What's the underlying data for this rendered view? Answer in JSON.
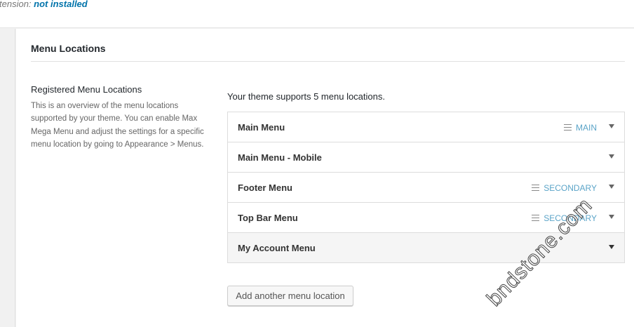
{
  "extension": {
    "label": "tension:",
    "status": "not installed"
  },
  "section": {
    "title": "Menu Locations"
  },
  "sidebar": {
    "heading": "Registered Menu Locations",
    "description": "This is an overview of the menu locations supported by your theme. You can enable Max Mega Menu and adjust the settings for a specific menu location by going to Appearance > Menus."
  },
  "main": {
    "intro": "Your theme supports 5 menu locations.",
    "locations": [
      {
        "name": "Main Menu",
        "tag": "MAIN",
        "icon": "menu-lines-icon"
      },
      {
        "name": "Main Menu - Mobile",
        "tag": ""
      },
      {
        "name": "Footer Menu",
        "tag": "SECONDARY",
        "icon": "menu-lines-icon"
      },
      {
        "name": "Top Bar Menu",
        "tag": "SECONDARY",
        "icon": "menu-lines-icon"
      },
      {
        "name": "My Account Menu",
        "tag": "",
        "active": true
      }
    ],
    "add_button": "Add another menu location"
  },
  "watermark": "bndstone.com",
  "colors": {
    "link": "#0073aa",
    "tag": "#5ba4c8"
  }
}
